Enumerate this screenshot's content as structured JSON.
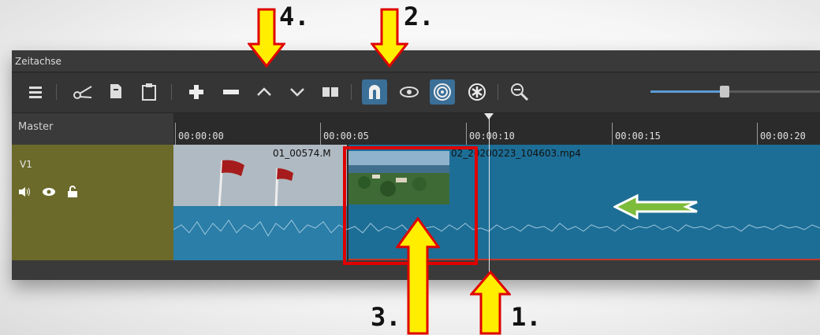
{
  "panel": {
    "title": "Zeitachse"
  },
  "toolbar": {
    "buttons": [
      {
        "name": "menu-icon"
      },
      {
        "name": "cut-icon"
      },
      {
        "name": "copy-icon"
      },
      {
        "name": "paste-icon"
      },
      {
        "name": "append-icon"
      },
      {
        "name": "remove-icon"
      },
      {
        "name": "lift-icon"
      },
      {
        "name": "overwrite-icon"
      },
      {
        "name": "split-icon"
      },
      {
        "name": "snap-icon",
        "active": true
      },
      {
        "name": "scrub-icon"
      },
      {
        "name": "ripple-icon",
        "active": true
      },
      {
        "name": "ripple-all-icon"
      },
      {
        "name": "zoom-out-icon"
      }
    ],
    "zoom_slider_value": 0.44
  },
  "tracks": {
    "master_label": "Master",
    "v1_label": "V1"
  },
  "ruler": {
    "ticks": [
      "00:00:00",
      "00:00:05",
      "00:00:10",
      "00:00:15",
      "00:00:20"
    ]
  },
  "clips": {
    "clip1_name": "01_00574.M",
    "clip2_name": "02_20200223_104603.mp4"
  },
  "annotations": {
    "a1": "1.",
    "a2": "2.",
    "a3": "3.",
    "a4": "4."
  },
  "colors": {
    "panel_bg": "#2f2f2f",
    "track_head": "#6b6a2a",
    "clip_blue": "#1d6e96",
    "accent": "#3a6f98",
    "annotation_arrow": "#ffee00",
    "annotation_outline": "#e00000",
    "green_arrow": "#7dbb3a"
  }
}
